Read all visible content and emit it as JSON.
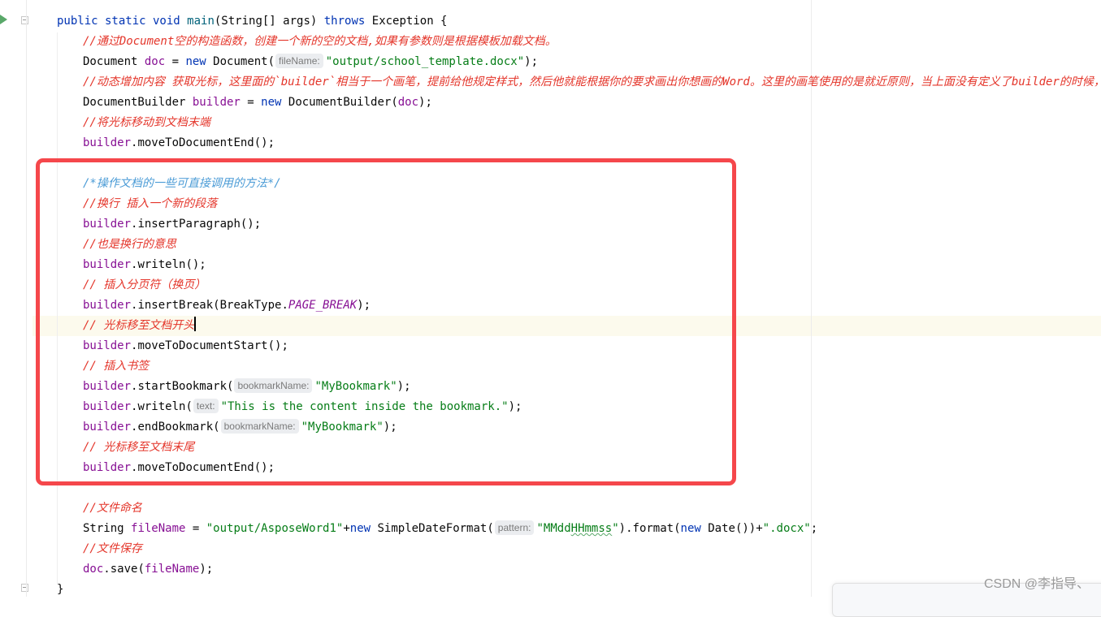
{
  "editor": {
    "lines": [
      {
        "parts": [
          [
            "kw",
            "public static void "
          ],
          [
            "fn",
            "main"
          ],
          [
            "brk",
            "(String[] "
          ],
          [
            "brk",
            "args"
          ],
          [
            "brk",
            ") "
          ],
          [
            "kw",
            "throws "
          ],
          [
            "brk",
            "Exception {"
          ]
        ]
      },
      {
        "parts": [
          [
            "cm-red",
            "//通过Document空的构造函数，创建一个新的空的文档,如果有参数则是根据模板加载文档。"
          ]
        ]
      },
      {
        "parts": [
          [
            "brk",
            "Document "
          ],
          [
            "var",
            "doc"
          ],
          [
            "brk",
            " = "
          ],
          [
            "kw",
            "new "
          ],
          [
            "brk",
            "Document("
          ],
          [
            "hint",
            "fileName:"
          ],
          [
            "str",
            "\"output/school_template.docx\""
          ],
          [
            "brk",
            ");"
          ]
        ]
      },
      {
        "parts": [
          [
            "cm-red",
            "//动态增加内容 获取光标，这里面的`builder`相当于一个画笔，提前给他规定样式，然后他就能根据你的要求画出你想画的Word。这里的画笔使用的是就近原则，当上面没有定义了builder的时候，会"
          ]
        ]
      },
      {
        "parts": [
          [
            "brk",
            "DocumentBuilder "
          ],
          [
            "var",
            "builder"
          ],
          [
            "brk",
            " = "
          ],
          [
            "kw",
            "new "
          ],
          [
            "brk",
            "DocumentBuilder("
          ],
          [
            "var",
            "doc"
          ],
          [
            "brk",
            ");"
          ]
        ]
      },
      {
        "parts": [
          [
            "cm-red",
            "//将光标移动到文档末端"
          ]
        ]
      },
      {
        "parts": [
          [
            "var",
            "builder"
          ],
          [
            "brk",
            ".moveToDocumentEnd();"
          ]
        ]
      },
      {
        "parts": []
      },
      {
        "parts": [
          [
            "cm-blue",
            "/*操作文档的一些可直接调用的方法*/"
          ]
        ]
      },
      {
        "parts": [
          [
            "cm-red",
            "//换行 插入一个新的段落"
          ]
        ]
      },
      {
        "parts": [
          [
            "var",
            "builder"
          ],
          [
            "brk",
            ".insertParagraph();"
          ]
        ]
      },
      {
        "parts": [
          [
            "cm-red",
            "//也是换行的意思"
          ]
        ]
      },
      {
        "parts": [
          [
            "var",
            "builder"
          ],
          [
            "brk",
            ".writeln();"
          ]
        ]
      },
      {
        "parts": [
          [
            "cm-red",
            "// 插入分页符（换页）"
          ]
        ]
      },
      {
        "parts": [
          [
            "var",
            "builder"
          ],
          [
            "brk",
            ".insertBreak(BreakType."
          ],
          [
            "const",
            "PAGE_BREAK"
          ],
          [
            "brk",
            ");"
          ]
        ]
      },
      {
        "parts": [
          [
            "cm-red",
            "// 光标移至文档开头"
          ],
          [
            "caret",
            ""
          ]
        ]
      },
      {
        "parts": [
          [
            "var",
            "builder"
          ],
          [
            "brk",
            ".moveToDocumentStart();"
          ]
        ]
      },
      {
        "parts": [
          [
            "cm-red",
            "// 插入书签"
          ]
        ]
      },
      {
        "parts": [
          [
            "var",
            "builder"
          ],
          [
            "brk",
            ".startBookmark("
          ],
          [
            "hint",
            "bookmarkName:"
          ],
          [
            "str",
            "\"MyBookmark\""
          ],
          [
            "brk",
            ");"
          ]
        ]
      },
      {
        "parts": [
          [
            "var",
            "builder"
          ],
          [
            "brk",
            ".writeln("
          ],
          [
            "hint",
            "text:"
          ],
          [
            "str",
            "\"This is the content inside the bookmark.\""
          ],
          [
            "brk",
            ");"
          ]
        ]
      },
      {
        "parts": [
          [
            "var",
            "builder"
          ],
          [
            "brk",
            ".endBookmark("
          ],
          [
            "hint",
            "bookmarkName:"
          ],
          [
            "str",
            "\"MyBookmark\""
          ],
          [
            "brk",
            ");"
          ]
        ]
      },
      {
        "parts": [
          [
            "cm-red",
            "// 光标移至文档末尾"
          ]
        ]
      },
      {
        "parts": [
          [
            "var",
            "builder"
          ],
          [
            "brk",
            ".moveToDocumentEnd();"
          ]
        ]
      },
      {
        "parts": []
      },
      {
        "parts": [
          [
            "cm-red",
            "//文件命名"
          ]
        ]
      },
      {
        "parts": [
          [
            "brk",
            "String "
          ],
          [
            "var",
            "fileName"
          ],
          [
            "brk",
            " = "
          ],
          [
            "str",
            "\"output/AsposeWord1\""
          ],
          [
            "brk",
            "+"
          ],
          [
            "kw",
            "new "
          ],
          [
            "brk",
            "SimpleDateFormat("
          ],
          [
            "hint",
            "pattern:"
          ],
          [
            "str",
            "\"MMdd"
          ],
          [
            "sq",
            "HHmmss"
          ],
          [
            "str",
            "\""
          ],
          [
            "brk",
            ").format("
          ],
          [
            "kw",
            "new "
          ],
          [
            "brk",
            "Date())+"
          ],
          [
            "str",
            "\".docx\""
          ],
          [
            "brk",
            ";"
          ]
        ]
      },
      {
        "parts": [
          [
            "cm-red",
            "//文件保存"
          ]
        ]
      },
      {
        "parts": [
          [
            "var",
            "doc"
          ],
          [
            "brk",
            ".save("
          ],
          [
            "var",
            "fileName"
          ],
          [
            "brk",
            ");"
          ]
        ]
      },
      {
        "parts": [
          [
            "brk",
            "}"
          ]
        ]
      }
    ],
    "watermark": "CSDN @李指导、"
  },
  "colors": {
    "keyword": "#0033b3",
    "string": "#067d17",
    "field": "#871094",
    "comment": "#e4352a",
    "doc_comment": "#4a9bd6",
    "highlight_box": "#f5474b",
    "current_line": "#fcfaed"
  },
  "icons": {
    "run": "run-gutter-icon",
    "fold": "fold-marker-icon"
  }
}
